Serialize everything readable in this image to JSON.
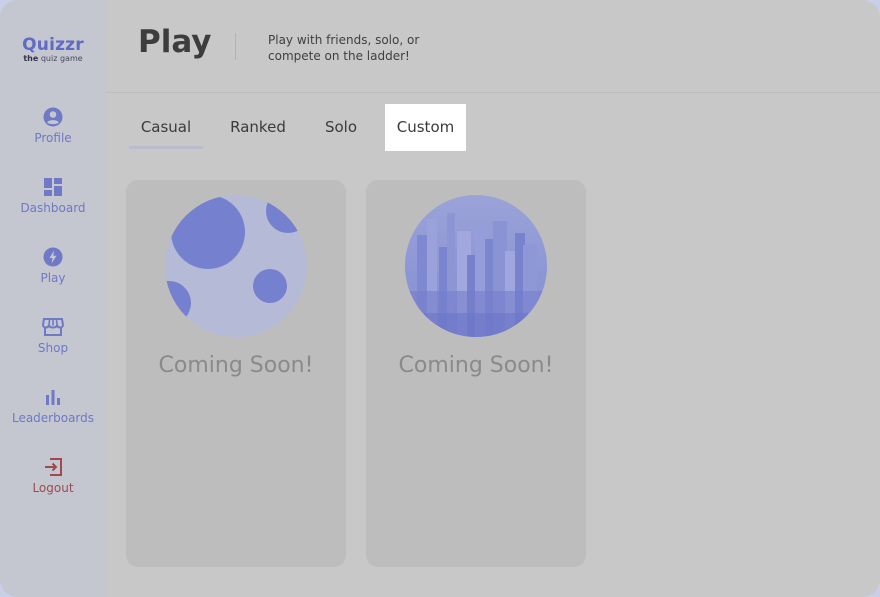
{
  "brand": {
    "title": "Quizzr",
    "sub_bold": "the",
    "sub_rest": "quiz game"
  },
  "sidebar": {
    "items": [
      {
        "label": "Profile",
        "icon": "profile-icon"
      },
      {
        "label": "Dashboard",
        "icon": "dashboard-icon"
      },
      {
        "label": "Play",
        "icon": "play-bolt-icon"
      },
      {
        "label": "Shop",
        "icon": "shop-icon"
      },
      {
        "label": "Leaderboards",
        "icon": "leaderboard-icon"
      },
      {
        "label": "Logout",
        "icon": "logout-icon"
      }
    ]
  },
  "header": {
    "title": "Play",
    "description": "Play with friends, solo, or compete on the ladder!"
  },
  "tabs": [
    {
      "label": "Casual",
      "state": "underlined"
    },
    {
      "label": "Ranked",
      "state": "normal"
    },
    {
      "label": "Solo",
      "state": "normal"
    },
    {
      "label": "Custom",
      "state": "selected"
    }
  ],
  "cards": [
    {
      "status": "Coming Soon!",
      "art": "moon-art"
    },
    {
      "status": "Coming Soon!",
      "art": "city-art"
    }
  ],
  "colors": {
    "accent": "#6f79c5",
    "logout": "#a04b4b",
    "art_blue": "#7580cf",
    "art_light": "#b5bad6"
  }
}
